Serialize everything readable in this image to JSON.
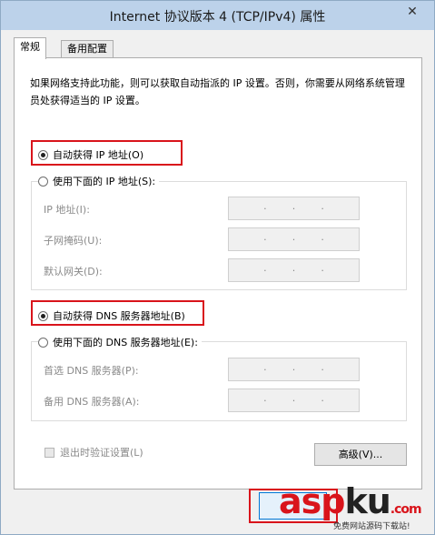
{
  "window": {
    "title": "Internet 协议版本 4 (TCP/IPv4) 属性",
    "close_glyph": "✕"
  },
  "tabs": [
    {
      "label": "常规",
      "active": true
    },
    {
      "label": "备用配置",
      "active": false
    }
  ],
  "description": "如果网络支持此功能，则可以获取自动指派的 IP 设置。否则，你需要从网络系统管理员处获得适当的 IP 设置。",
  "ip_section": {
    "auto_option": {
      "label": "自动获得 IP 地址(O)",
      "checked": true
    },
    "manual_option": {
      "label": "使用下面的 IP 地址(S):",
      "checked": false
    },
    "fields": [
      {
        "label": "IP 地址(I):",
        "value": ""
      },
      {
        "label": "子网掩码(U):",
        "value": ""
      },
      {
        "label": "默认网关(D):",
        "value": ""
      }
    ]
  },
  "dns_section": {
    "auto_option": {
      "label": "自动获得 DNS 服务器地址(B)",
      "checked": true
    },
    "manual_option": {
      "label": "使用下面的 DNS 服务器地址(E):",
      "checked": false
    },
    "fields": [
      {
        "label": "首选 DNS 服务器(P):",
        "value": ""
      },
      {
        "label": "备用 DNS 服务器(A):",
        "value": ""
      }
    ]
  },
  "validate_checkbox": {
    "label": "退出时验证设置(L)",
    "checked": false
  },
  "advanced_button": "高级(V)...",
  "ok_button": "",
  "ip_dot": "·",
  "watermark": {
    "logo_part1": "asp",
    "logo_part2": "ku",
    "logo_suffix": ".com",
    "subtitle": "免费网站源码下载站!"
  },
  "colors": {
    "highlight": "#d9141b",
    "titlebar": "#bcd2ea"
  }
}
